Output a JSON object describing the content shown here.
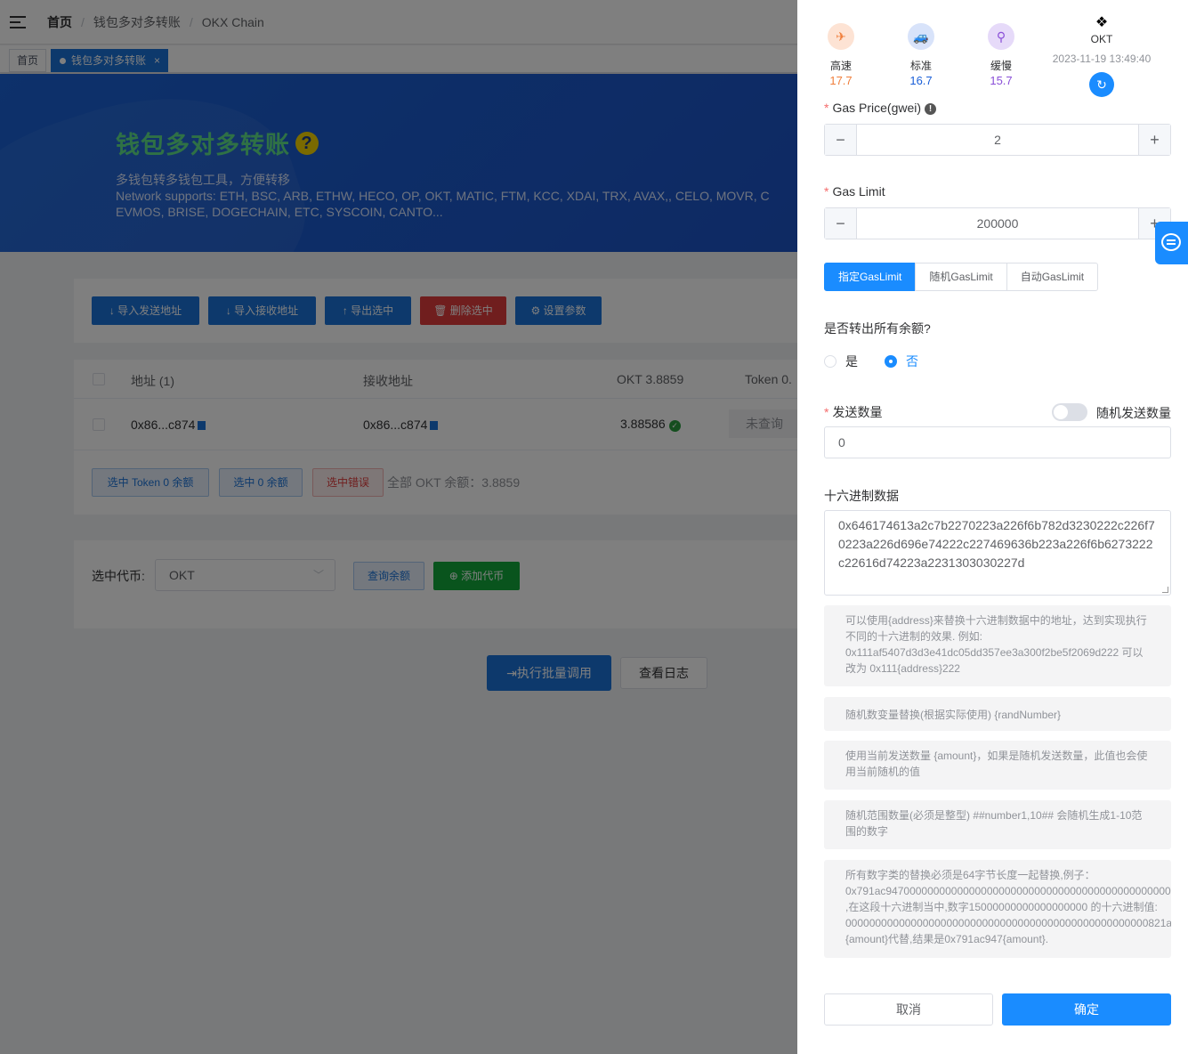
{
  "breadcrumb": [
    "首页",
    "钱包多对多转账",
    "OKX Chain"
  ],
  "tags": {
    "home": "首页",
    "active": "钱包多对多转账",
    "close": "×"
  },
  "banner": {
    "title": "钱包多对多转账",
    "help_icon": "?",
    "line1": "多钱包转多钱包工具，方便转移",
    "line2": "Network supports:  ETH, BSC, ARB, ETHW, HECO, OP, OKT, MATIC, FTM, KCC, XDAI, TRX, AVAX,, CELO, MOVR, C",
    "line3": "EVMOS, BRISE, DOGECHAIN, ETC, SYSCOIN, CANTO..."
  },
  "toolbar": {
    "import_send": "↓ 导入发送地址",
    "import_receive": "↓ 导入接收地址",
    "export": "↑ 导出选中",
    "delete": "🗑 删除选中",
    "settings": "⚙ 设置参数"
  },
  "table": {
    "headers": [
      "地址 (1)",
      "接收地址",
      "OKT 3.8859",
      "Token 0."
    ],
    "rows": [
      {
        "address": "0x86...c874",
        "receiver": "0x86...c874",
        "balance": "3.88586",
        "token": "未查询"
      }
    ]
  },
  "table_actions": {
    "select_token_zero": "选中 Token 0 余额",
    "select_zero": "选中 0 余额",
    "select_error": "选中错误",
    "total": "全部 OKT 余额：3.8859"
  },
  "token_section": {
    "label": "选中代币:",
    "selected": "OKT",
    "query": "查询余额",
    "add": "⊕ 添加代币"
  },
  "actions": {
    "execute": "执行批量调用",
    "logs": "查看日志"
  },
  "drawer": {
    "gas_options": [
      {
        "label": "高速",
        "value": "17.7",
        "color": "#f07f3c",
        "icon": "rocket-icon"
      },
      {
        "label": "标准",
        "value": "16.7",
        "color": "#1a5fd8",
        "icon": "car-icon"
      },
      {
        "label": "缓慢",
        "value": "15.7",
        "color": "#8a4fd8",
        "icon": "bicycle-icon"
      }
    ],
    "chain_name": "OKT",
    "timestamp": "2023-11-19 13:49:40",
    "gas_price_label": "Gas Price(gwei)",
    "gas_price_value": "2",
    "gas_limit_label": "Gas Limit",
    "gas_limit_value": "200000",
    "gas_limit_modes": [
      "指定GasLimit",
      "随机GasLimit",
      "自动GasLimit"
    ],
    "transfer_all_label": "是否转出所有余额?",
    "yes": "是",
    "no": "否",
    "send_amount_label": "发送数量",
    "random_amount_label": "随机发送数量",
    "send_amount_value": "0",
    "hex_label": "十六进制数据",
    "hex_value": "0x646174613a2c7b2270223a226f6b782d3230222c226f70223a226d696e74222c227469636b223a226f6b6273222c22616d74223a2231303030227d",
    "tips": [
      "可以使用{address}来替换十六进制数据中的地址，达到实现执行不同的十六进制的效果. 例如: 0x111af5407d3d3e41dc05dd357ee3a300f2be5f2069d222 可以改为 0x111{address}222",
      "随机数变量替换(根据实际使用) {randNumber}",
      "使用当前发送数量 {amount}，如果是随机发送数量，此值也会使用当前随机的值",
      "随机范围数量(必须是整型) ##number1,10## 会随机生成1-10范围的数字"
    ],
    "tip5": [
      "所有数字类的替换必须是64字节长度一起替换,例子：",
      "0x791ac947000000000000000000000000000000000000000000000",
      ",在这段十六进制当中,数字15000000000000000000 的十六进制值:",
      "000000000000000000000000000000000000000000000000000821ab",
      "{amount}代替,结果是0x791ac947{amount}."
    ],
    "cancel": "取消",
    "confirm": "确定"
  }
}
